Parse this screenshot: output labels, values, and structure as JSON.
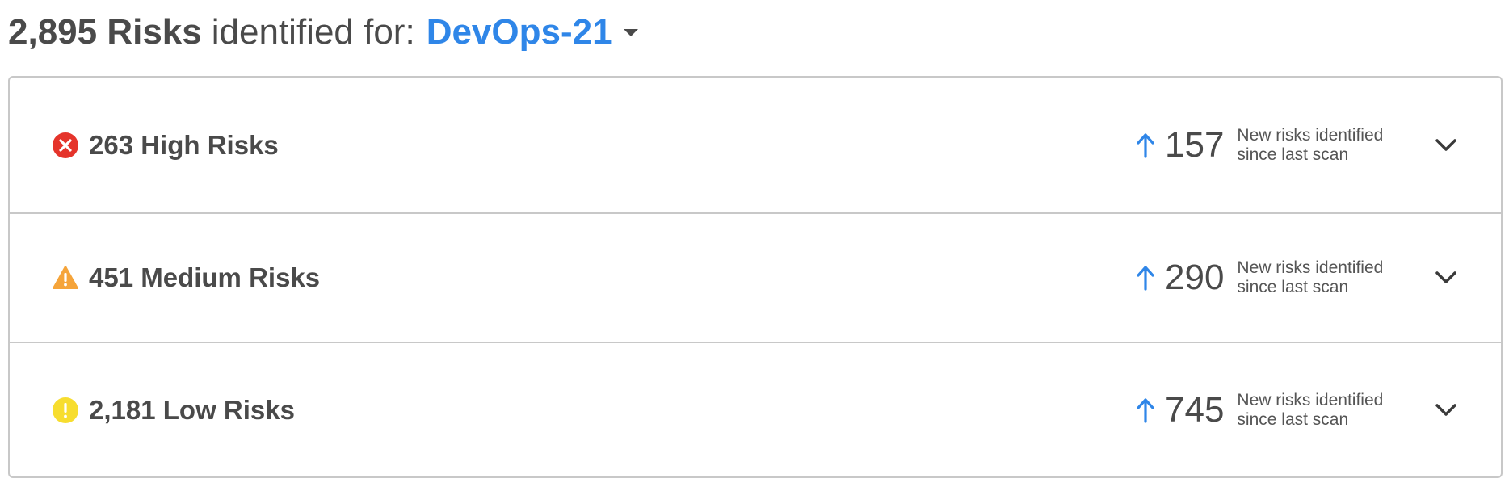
{
  "header": {
    "total_label": "2,895 Risks",
    "identified_for_label": "identified for:",
    "project_name": "DevOps-21"
  },
  "risk_rows": [
    {
      "severity": "high",
      "icon": "error-circle-icon",
      "icon_color": "#e5342b",
      "label": "263 High Risks",
      "new_count": "157",
      "new_note_line1": "New risks identified",
      "new_note_line2": "since last scan"
    },
    {
      "severity": "medium",
      "icon": "warning-triangle-icon",
      "icon_color": "#f5a43a",
      "label": "451 Medium Risks",
      "new_count": "290",
      "new_note_line1": "New risks identified",
      "new_note_line2": "since last scan"
    },
    {
      "severity": "low",
      "icon": "info-circle-icon",
      "icon_color": "#f7dd2f",
      "label": "2,181 Low Risks",
      "new_count": "745",
      "new_note_line1": "New risks identified",
      "new_note_line2": "since last scan"
    }
  ],
  "colors": {
    "accent": "#2f86e8",
    "text": "#4a4a4a",
    "border": "#c8c8c8"
  }
}
